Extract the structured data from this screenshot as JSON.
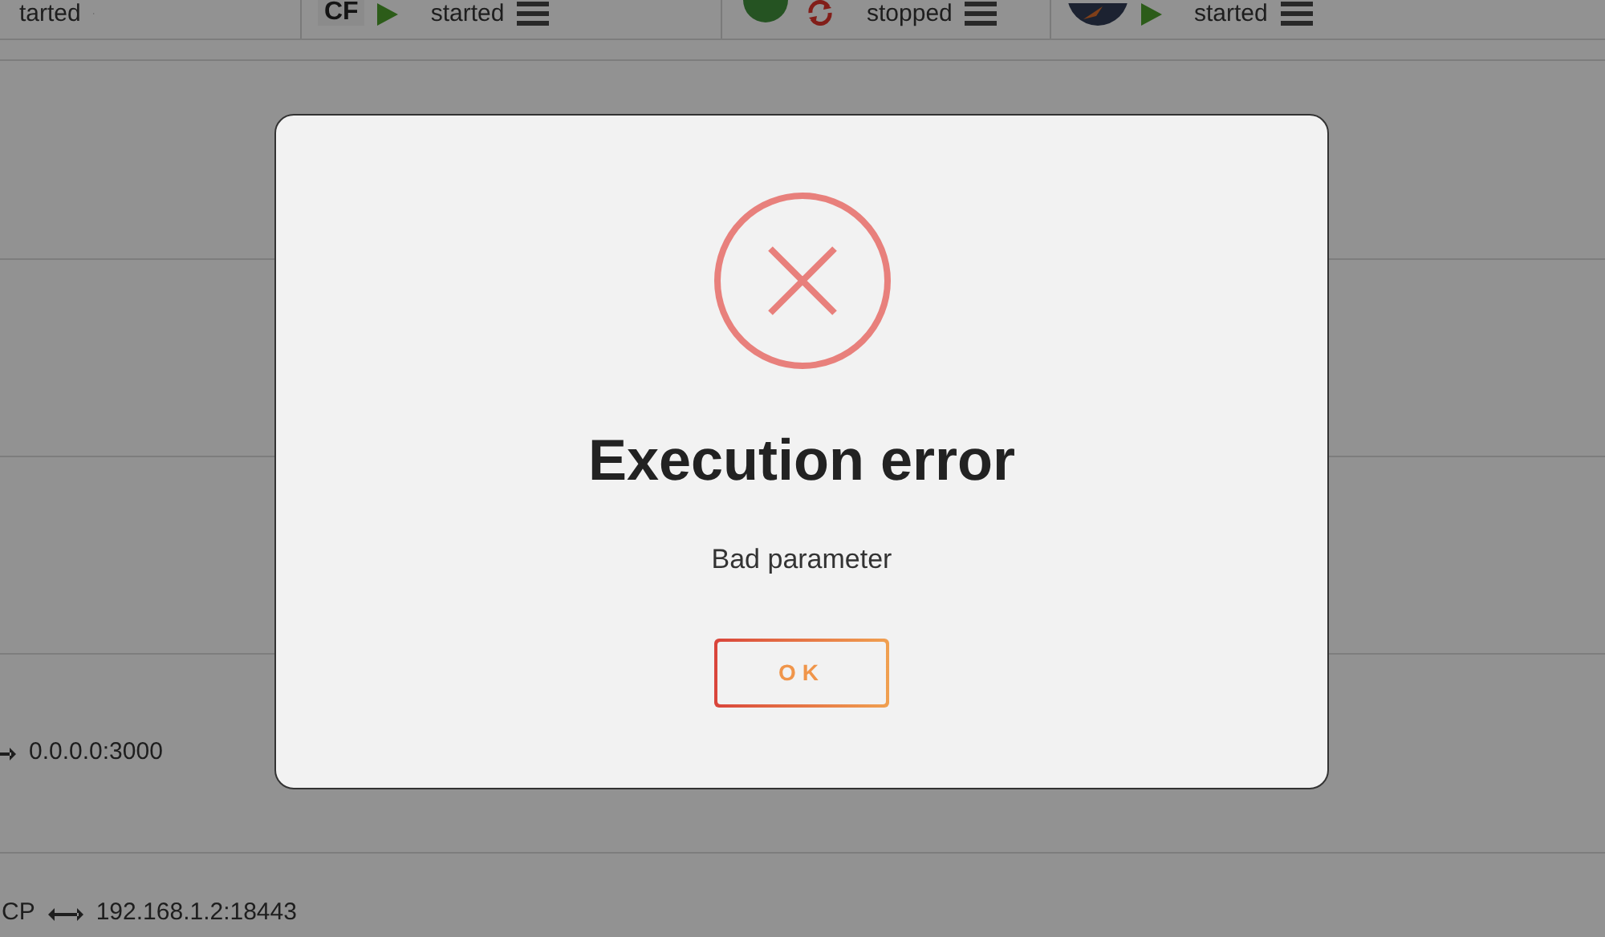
{
  "services": [
    {
      "status": "tarted"
    },
    {
      "logo": {
        "kind": "text",
        "text": "CF"
      },
      "status": "started",
      "running": true
    },
    {
      "logo": {
        "kind": "globe"
      },
      "status": "stopped",
      "running": false
    },
    {
      "logo": {
        "kind": "rocket"
      },
      "status": "started",
      "running": true
    }
  ],
  "ports": [
    {
      "address": "0.0.0.0:3000"
    },
    {
      "protocol": "CP",
      "address": "192.168.1.2:18443"
    }
  ],
  "dialog": {
    "title": "Execution error",
    "message": "Bad parameter",
    "button": "OK"
  }
}
